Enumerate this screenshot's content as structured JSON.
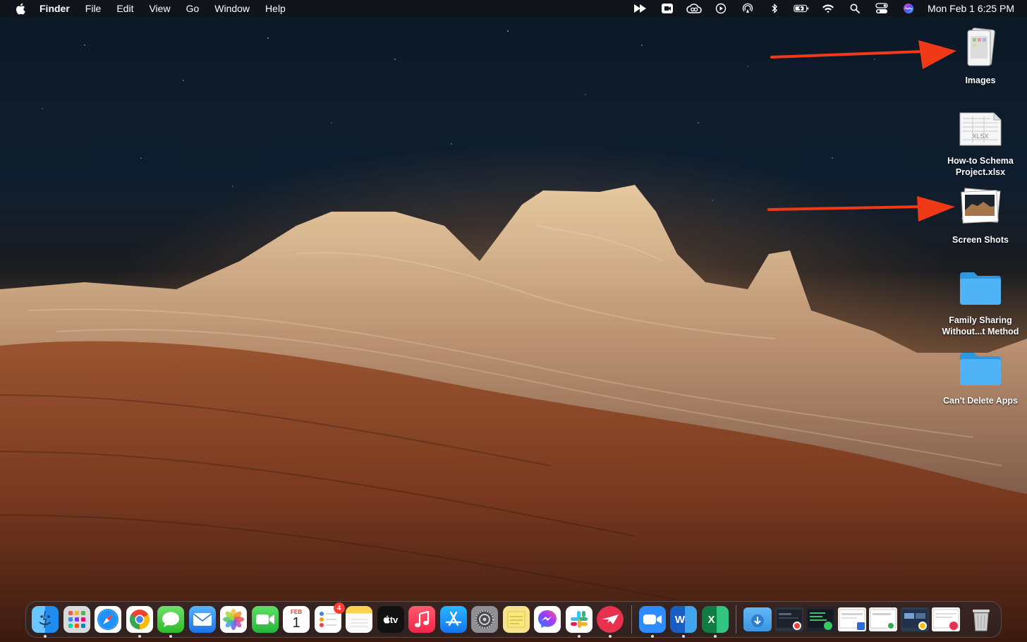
{
  "menubar": {
    "apple_icon": "apple-logo-icon",
    "app_name": "Finder",
    "menus": [
      "File",
      "Edit",
      "View",
      "Go",
      "Window",
      "Help"
    ],
    "status_icons": [
      "media-forward-icon",
      "screen-record-icon",
      "creative-cloud-icon",
      "play-circle-icon",
      "airdrop-icon",
      "bluetooth-icon",
      "battery-charging-icon",
      "wifi-icon",
      "search-icon",
      "control-center-icon",
      "siri-icon"
    ],
    "clock": "Mon Feb 1  6:25 PM"
  },
  "desktop": {
    "icons": [
      {
        "label": "Images",
        "icon": "image-stack-icon"
      },
      {
        "label": "How-to Schema Project.xlsx",
        "icon": "xlsx-file-icon"
      },
      {
        "label": "Screen Shots",
        "icon": "screenshot-stack-icon"
      },
      {
        "label": "Family Sharing Without...t Method",
        "icon": "folder-icon"
      },
      {
        "label": "Can't Delete Apps",
        "icon": "folder-icon"
      }
    ],
    "file_badge_text": "XLSX"
  },
  "dock": {
    "apps": [
      {
        "name": "Finder",
        "running": true
      },
      {
        "name": "Launchpad",
        "running": false
      },
      {
        "name": "Safari",
        "running": false
      },
      {
        "name": "Google Chrome",
        "running": true
      },
      {
        "name": "Messages",
        "running": true
      },
      {
        "name": "Mail",
        "running": false
      },
      {
        "name": "Photos",
        "running": false
      },
      {
        "name": "FaceTime",
        "running": false
      },
      {
        "name": "Calendar",
        "running": false,
        "month": "FEB",
        "day": "1"
      },
      {
        "name": "Reminders",
        "running": false,
        "badge": "4"
      },
      {
        "name": "Notes",
        "running": false
      },
      {
        "name": "TV",
        "running": false,
        "text": "tv"
      },
      {
        "name": "Music",
        "running": false
      },
      {
        "name": "App Store",
        "running": false
      },
      {
        "name": "System Preferences",
        "running": false
      },
      {
        "name": "Stickies",
        "running": false
      },
      {
        "name": "Messenger",
        "running": false
      },
      {
        "name": "Slack",
        "running": true
      },
      {
        "name": "Airmail",
        "running": true
      },
      {
        "name": "Zoom",
        "running": true
      },
      {
        "name": "Microsoft Word",
        "running": true,
        "text": "W"
      },
      {
        "name": "Microsoft Excel",
        "running": true,
        "text": "X"
      }
    ],
    "stacks": [
      "Downloads",
      "Recent Window 1",
      "Recent Window 2",
      "Recent Window 3",
      "Recent Window 4",
      "Recent Window 5",
      "Recent Window 6"
    ],
    "trash": "Trash"
  },
  "colors": {
    "arrow": "#f03a17",
    "folder": "#3aa6ef",
    "menubar_bg": "#141418"
  }
}
